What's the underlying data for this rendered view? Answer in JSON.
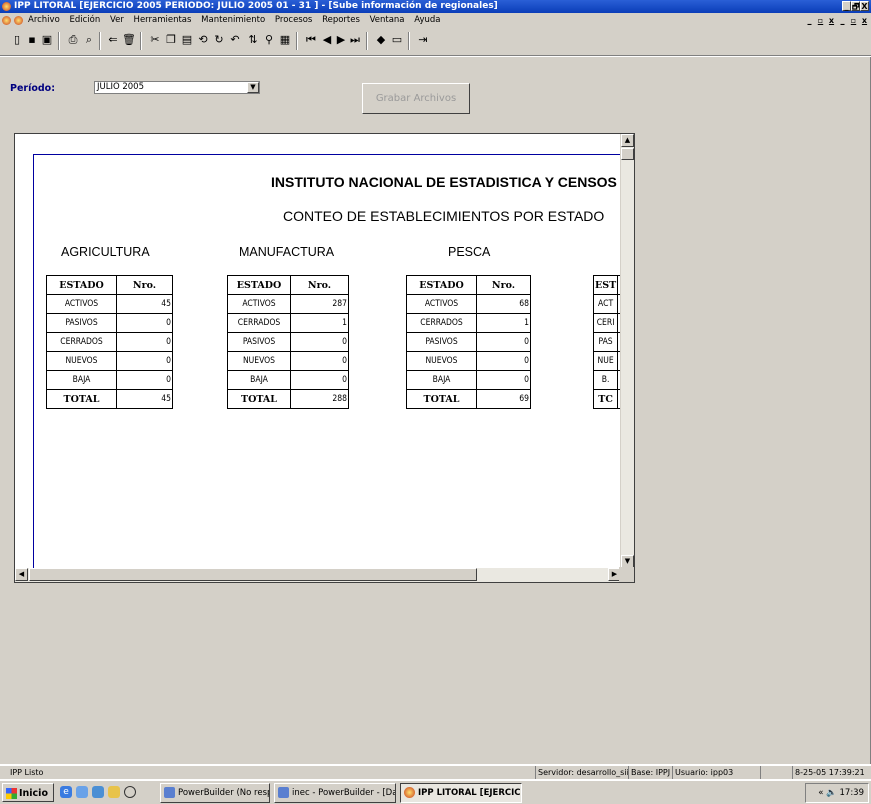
{
  "window": {
    "title": "IPP LITORAL [EJERCICIO 2005 PERIODO: JULIO 2005 01 - 31 ] - [Sube información de regionales]",
    "controls": [
      "_",
      "🗗",
      "X"
    ]
  },
  "menu": {
    "items": [
      "Archivo",
      "Edición",
      "Ver",
      "Herramientas",
      "Mantenimiento",
      "Procesos",
      "Reportes",
      "Ventana",
      "Ayuda"
    ]
  },
  "toolbar": {
    "icons": [
      "new-icon",
      "save-icon",
      "save-as-icon",
      "print-icon",
      "print-preview-icon",
      "insert-icon",
      "delete-icon",
      "cut-icon",
      "copy-icon",
      "paste-icon",
      "retrieve-icon",
      "refresh-icon",
      "undo-icon",
      "sort-icon",
      "filter-icon",
      "calendar-icon",
      "first-icon",
      "previous-icon",
      "next-icon",
      "last-icon",
      "update-icon",
      "window-icon",
      "exit-icon"
    ]
  },
  "form": {
    "periodo_label": "Período:",
    "periodo_value": "JULIO 2005",
    "grabar_label": "Grabar Archivos"
  },
  "report": {
    "title": "INSTITUTO NACIONAL DE ESTADISTICA Y CENSOS",
    "subtitle": "CONTEO DE ESTABLECIMIENTOS POR ESTADO",
    "sections": [
      {
        "name": "AGRICULTURA",
        "col_estado": "ESTADO",
        "col_nro": "Nro.",
        "rows": [
          {
            "estado": "ACTIVOS",
            "nro": "45"
          },
          {
            "estado": "PASIVOS",
            "nro": "0"
          },
          {
            "estado": "CERRADOS",
            "nro": "0"
          },
          {
            "estado": "NUEVOS",
            "nro": "0"
          },
          {
            "estado": "BAJA",
            "nro": "0"
          }
        ],
        "total_label": "TOTAL",
        "total_value": "45"
      },
      {
        "name": "MANUFACTURA",
        "col_estado": "ESTADO",
        "col_nro": "Nro.",
        "rows": [
          {
            "estado": "ACTIVOS",
            "nro": "287"
          },
          {
            "estado": "CERRADOS",
            "nro": "1"
          },
          {
            "estado": "PASIVOS",
            "nro": "0"
          },
          {
            "estado": "NUEVOS",
            "nro": "0"
          },
          {
            "estado": "BAJA",
            "nro": "0"
          }
        ],
        "total_label": "TOTAL",
        "total_value": "288"
      },
      {
        "name": "PESCA",
        "col_estado": "ESTADO",
        "col_nro": "Nro.",
        "rows": [
          {
            "estado": "ACTIVOS",
            "nro": "68"
          },
          {
            "estado": "CERRADOS",
            "nro": "1"
          },
          {
            "estado": "PASIVOS",
            "nro": "0"
          },
          {
            "estado": "NUEVOS",
            "nro": "0"
          },
          {
            "estado": "BAJA",
            "nro": "0"
          }
        ],
        "total_label": "TOTAL",
        "total_value": "69"
      },
      {
        "name": "",
        "col_estado": "EST",
        "col_nro": "",
        "rows": [
          {
            "estado": "ACT",
            "nro": ""
          },
          {
            "estado": "CERI",
            "nro": ""
          },
          {
            "estado": "PAS",
            "nro": ""
          },
          {
            "estado": "NUE",
            "nro": ""
          },
          {
            "estado": "B.",
            "nro": ""
          }
        ],
        "total_label": "TC",
        "total_value": ""
      }
    ]
  },
  "status": {
    "left": "IPP Listo",
    "servidor": "Servidor: desarrollo_sii",
    "base": "Base: IPPJ",
    "usuario": "Usuario: ipp03",
    "datetime": "8-25-05 17:39:21"
  },
  "taskbar": {
    "start": "Inicio",
    "tasks": [
      "PowerBuilder (No respon...",
      "inec - PowerBuilder - [Da...",
      "IPP LITORAL [EJERCIC..."
    ],
    "clock": "17:39",
    "tray_chevron": "«"
  }
}
